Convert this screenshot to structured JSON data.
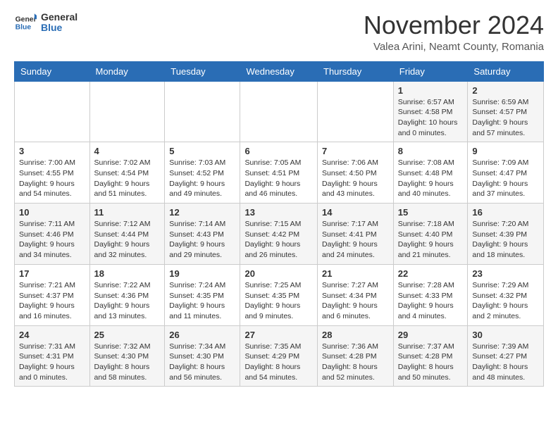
{
  "header": {
    "logo_general": "General",
    "logo_blue": "Blue",
    "month": "November 2024",
    "location": "Valea Arini, Neamt County, Romania"
  },
  "weekdays": [
    "Sunday",
    "Monday",
    "Tuesday",
    "Wednesday",
    "Thursday",
    "Friday",
    "Saturday"
  ],
  "weeks": [
    [
      {
        "day": "",
        "info": ""
      },
      {
        "day": "",
        "info": ""
      },
      {
        "day": "",
        "info": ""
      },
      {
        "day": "",
        "info": ""
      },
      {
        "day": "",
        "info": ""
      },
      {
        "day": "1",
        "info": "Sunrise: 6:57 AM\nSunset: 4:58 PM\nDaylight: 10 hours and 0 minutes."
      },
      {
        "day": "2",
        "info": "Sunrise: 6:59 AM\nSunset: 4:57 PM\nDaylight: 9 hours and 57 minutes."
      }
    ],
    [
      {
        "day": "3",
        "info": "Sunrise: 7:00 AM\nSunset: 4:55 PM\nDaylight: 9 hours and 54 minutes."
      },
      {
        "day": "4",
        "info": "Sunrise: 7:02 AM\nSunset: 4:54 PM\nDaylight: 9 hours and 51 minutes."
      },
      {
        "day": "5",
        "info": "Sunrise: 7:03 AM\nSunset: 4:52 PM\nDaylight: 9 hours and 49 minutes."
      },
      {
        "day": "6",
        "info": "Sunrise: 7:05 AM\nSunset: 4:51 PM\nDaylight: 9 hours and 46 minutes."
      },
      {
        "day": "7",
        "info": "Sunrise: 7:06 AM\nSunset: 4:50 PM\nDaylight: 9 hours and 43 minutes."
      },
      {
        "day": "8",
        "info": "Sunrise: 7:08 AM\nSunset: 4:48 PM\nDaylight: 9 hours and 40 minutes."
      },
      {
        "day": "9",
        "info": "Sunrise: 7:09 AM\nSunset: 4:47 PM\nDaylight: 9 hours and 37 minutes."
      }
    ],
    [
      {
        "day": "10",
        "info": "Sunrise: 7:11 AM\nSunset: 4:46 PM\nDaylight: 9 hours and 34 minutes."
      },
      {
        "day": "11",
        "info": "Sunrise: 7:12 AM\nSunset: 4:44 PM\nDaylight: 9 hours and 32 minutes."
      },
      {
        "day": "12",
        "info": "Sunrise: 7:14 AM\nSunset: 4:43 PM\nDaylight: 9 hours and 29 minutes."
      },
      {
        "day": "13",
        "info": "Sunrise: 7:15 AM\nSunset: 4:42 PM\nDaylight: 9 hours and 26 minutes."
      },
      {
        "day": "14",
        "info": "Sunrise: 7:17 AM\nSunset: 4:41 PM\nDaylight: 9 hours and 24 minutes."
      },
      {
        "day": "15",
        "info": "Sunrise: 7:18 AM\nSunset: 4:40 PM\nDaylight: 9 hours and 21 minutes."
      },
      {
        "day": "16",
        "info": "Sunrise: 7:20 AM\nSunset: 4:39 PM\nDaylight: 9 hours and 18 minutes."
      }
    ],
    [
      {
        "day": "17",
        "info": "Sunrise: 7:21 AM\nSunset: 4:37 PM\nDaylight: 9 hours and 16 minutes."
      },
      {
        "day": "18",
        "info": "Sunrise: 7:22 AM\nSunset: 4:36 PM\nDaylight: 9 hours and 13 minutes."
      },
      {
        "day": "19",
        "info": "Sunrise: 7:24 AM\nSunset: 4:35 PM\nDaylight: 9 hours and 11 minutes."
      },
      {
        "day": "20",
        "info": "Sunrise: 7:25 AM\nSunset: 4:35 PM\nDaylight: 9 hours and 9 minutes."
      },
      {
        "day": "21",
        "info": "Sunrise: 7:27 AM\nSunset: 4:34 PM\nDaylight: 9 hours and 6 minutes."
      },
      {
        "day": "22",
        "info": "Sunrise: 7:28 AM\nSunset: 4:33 PM\nDaylight: 9 hours and 4 minutes."
      },
      {
        "day": "23",
        "info": "Sunrise: 7:29 AM\nSunset: 4:32 PM\nDaylight: 9 hours and 2 minutes."
      }
    ],
    [
      {
        "day": "24",
        "info": "Sunrise: 7:31 AM\nSunset: 4:31 PM\nDaylight: 9 hours and 0 minutes."
      },
      {
        "day": "25",
        "info": "Sunrise: 7:32 AM\nSunset: 4:30 PM\nDaylight: 8 hours and 58 minutes."
      },
      {
        "day": "26",
        "info": "Sunrise: 7:34 AM\nSunset: 4:30 PM\nDaylight: 8 hours and 56 minutes."
      },
      {
        "day": "27",
        "info": "Sunrise: 7:35 AM\nSunset: 4:29 PM\nDaylight: 8 hours and 54 minutes."
      },
      {
        "day": "28",
        "info": "Sunrise: 7:36 AM\nSunset: 4:28 PM\nDaylight: 8 hours and 52 minutes."
      },
      {
        "day": "29",
        "info": "Sunrise: 7:37 AM\nSunset: 4:28 PM\nDaylight: 8 hours and 50 minutes."
      },
      {
        "day": "30",
        "info": "Sunrise: 7:39 AM\nSunset: 4:27 PM\nDaylight: 8 hours and 48 minutes."
      }
    ]
  ]
}
